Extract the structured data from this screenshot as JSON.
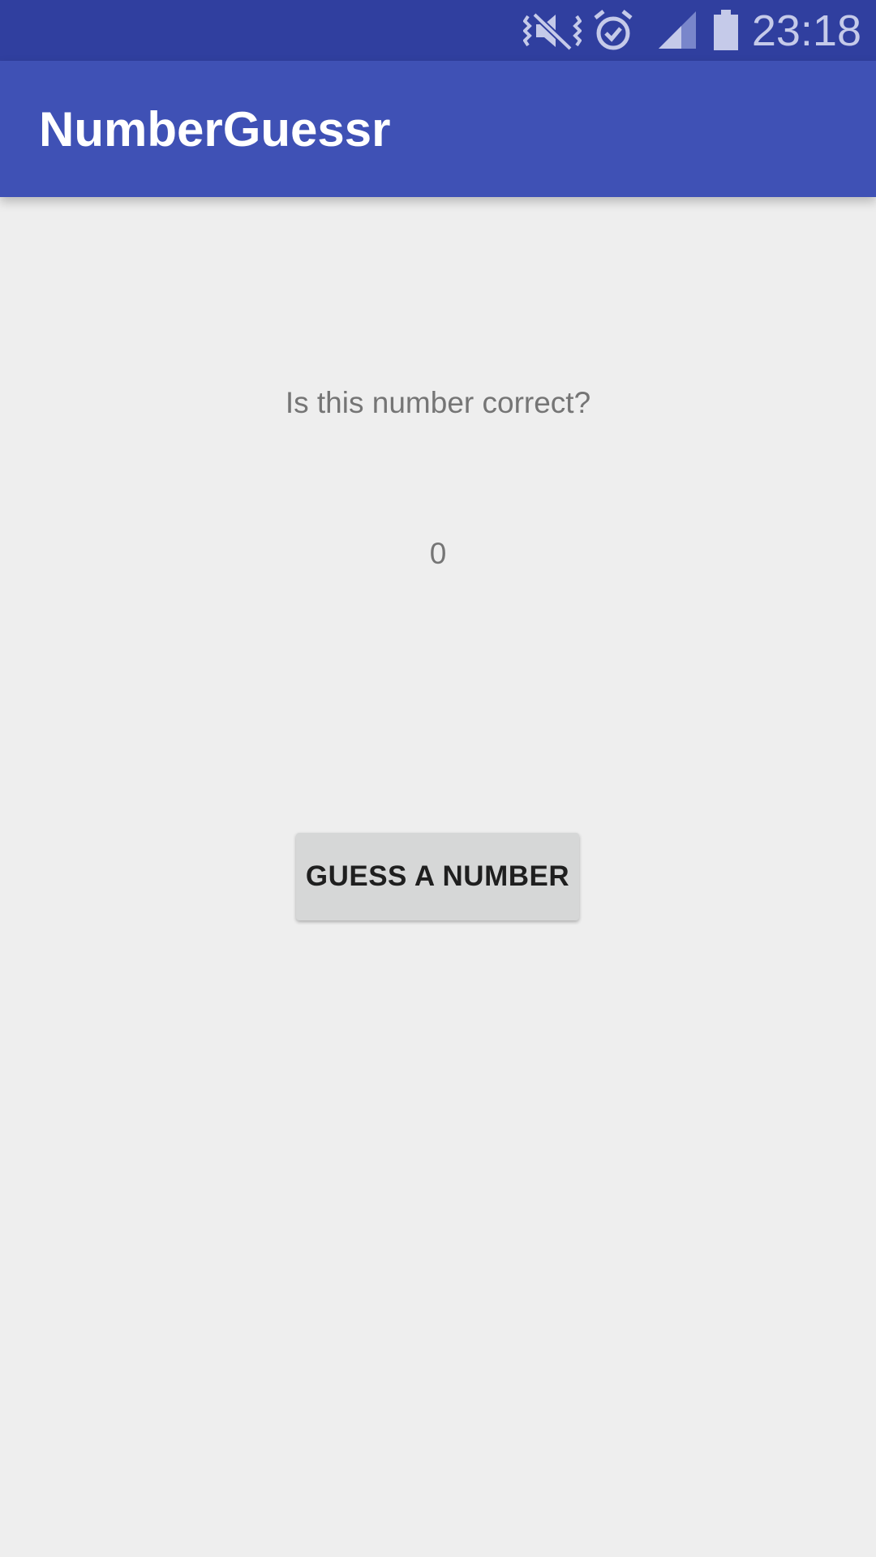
{
  "status_bar": {
    "time": "23:18",
    "icons": [
      "vibrate-mute-icon",
      "alarm-icon",
      "signal-icon",
      "battery-icon"
    ],
    "color": "#303F9F"
  },
  "app_bar": {
    "title": "NumberGuessr",
    "color": "#3F51B5"
  },
  "main": {
    "prompt": "Is this number correct?",
    "number": "0",
    "guess_button_label": "GUESS A NUMBER"
  },
  "colors": {
    "background": "#EEEEEE",
    "text_secondary": "#757575",
    "button_bg": "#D6D7D7"
  }
}
